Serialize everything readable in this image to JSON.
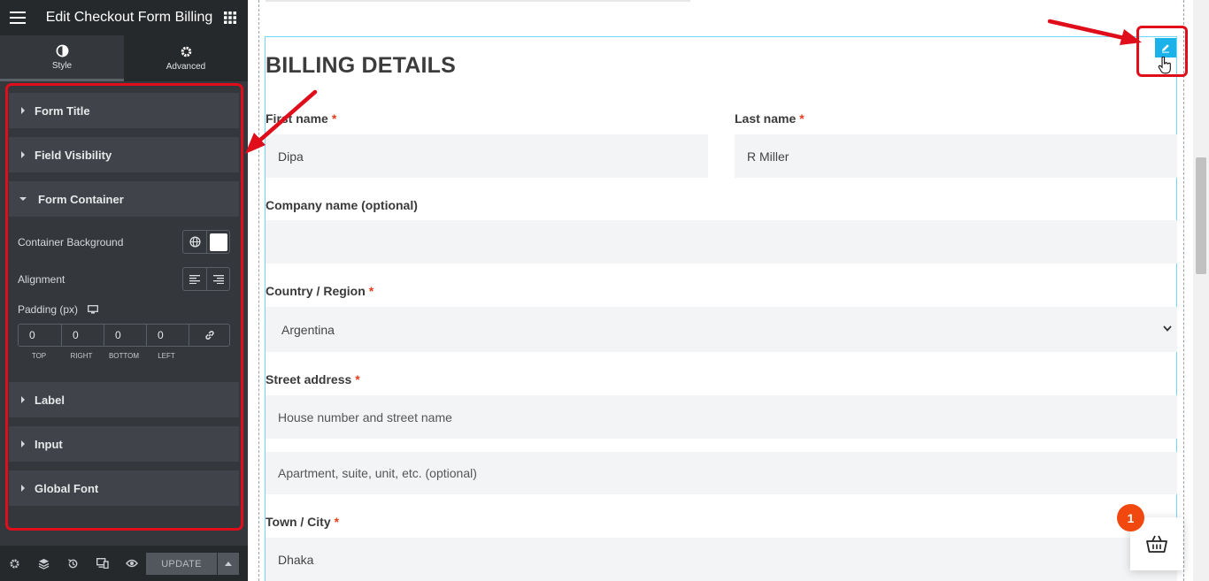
{
  "sidebar": {
    "title": "Edit Checkout Form Billing",
    "tabs": [
      {
        "label": "Style",
        "icon": "half-circle-icon",
        "active": true
      },
      {
        "label": "Advanced",
        "icon": "gear-icon",
        "active": false
      }
    ],
    "sections": {
      "form_title": "Form Title",
      "field_visibility": "Field Visibility",
      "form_container": "Form Container",
      "label": "Label",
      "input": "Input",
      "global_font": "Global Font"
    },
    "controls": {
      "container_background": "Container Background",
      "alignment": "Alignment",
      "padding": "Padding (px)",
      "padding_values": [
        "0",
        "0",
        "0",
        "0"
      ],
      "padding_labels": [
        "TOP",
        "RIGHT",
        "BOTTOM",
        "LEFT"
      ]
    },
    "footer": {
      "update_label": "UPDATE"
    }
  },
  "form": {
    "title": "BILLING DETAILS",
    "required_mark": "*",
    "first_name": {
      "label": "First name",
      "value": "Dipa"
    },
    "last_name": {
      "label": "Last name",
      "value": "R Miller"
    },
    "company": {
      "label": "Company name (optional)",
      "value": ""
    },
    "country": {
      "label": "Country / Region",
      "value": "Argentina"
    },
    "street": {
      "label": "Street address",
      "placeholder1": "House number and street name",
      "placeholder2": "Apartment, suite, unit, etc. (optional)"
    },
    "city": {
      "label": "Town / City",
      "value": "Dhaka"
    }
  },
  "cart": {
    "count": "1"
  },
  "colors": {
    "accent": "#1bb2ea",
    "highlight": "#e00d1a",
    "badge": "#f0480f",
    "required": "#e2401c"
  }
}
